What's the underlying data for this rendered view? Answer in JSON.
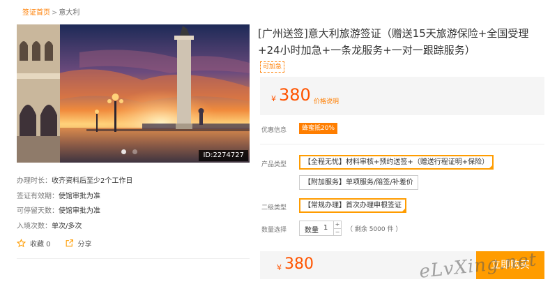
{
  "breadcrumb": {
    "home": "签证首页",
    "separator": ">",
    "current": "意大利"
  },
  "hero": {
    "id_label": "ID:2274727",
    "slides": 2,
    "active_slide": 1
  },
  "info": [
    {
      "label": "办理时长：",
      "value": "收齐资料后至少2个工作日"
    },
    {
      "label": "签证有效期：",
      "value": "使馆审批为准"
    },
    {
      "label": "可停留天数：",
      "value": "使馆审批为准"
    },
    {
      "label": "入境次数：",
      "value": "单次/多次"
    }
  ],
  "actions": {
    "favorite": "收藏 0",
    "share": "分享"
  },
  "product": {
    "title": "[广州送签]意大利旅游签证（赠送15天旅游保险+全国受理+24小时加急+一条龙服务+一对一跟踪服务）",
    "urgent_tag": "可加急",
    "price": {
      "currency": "¥",
      "amount": "380",
      "note": "价格说明"
    }
  },
  "promo": {
    "label": "优惠信息",
    "badge": "蜂蜜抵20%"
  },
  "product_type": {
    "label": "产品类型",
    "options": [
      {
        "text": "【全程无忧】材料审核+预约送签+（赠送行程证明+保险）",
        "selected": true
      },
      {
        "text": "【附加服务】单项服务/陪签/补差价",
        "selected": false
      }
    ]
  },
  "sub_type": {
    "label": "二级类型",
    "options": [
      {
        "text": "【常规办理】首次办理申根签证",
        "selected": true
      }
    ]
  },
  "quantity": {
    "label": "数量选择",
    "field_label": "数量",
    "value": "1",
    "plus": "+",
    "minus": "−",
    "stock": "（ 剩余 5000 件 ）"
  },
  "buy": {
    "currency": "¥",
    "amount": "380",
    "button": "立即购买"
  },
  "watermark": "eLvXing.net",
  "colors": {
    "accent": "#ff7e00",
    "price": "#ff5400",
    "buy": "#ff9c00"
  }
}
